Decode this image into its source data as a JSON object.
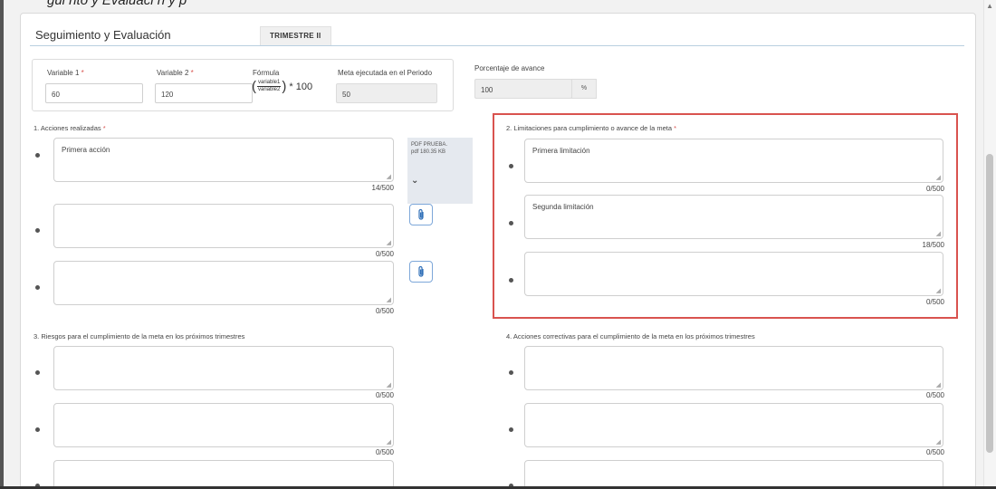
{
  "caption": "gui    nto y Evaluaci    n     y           p",
  "header": {
    "section_title": "Seguimiento y Evaluación",
    "tab_label": "TRIMESTRE II"
  },
  "variables": {
    "variable1_label": "Variable 1",
    "variable1_value": "60",
    "variable2_label": "Variable 2",
    "variable2_value": "120",
    "required_mark": "*",
    "formula_label": "Fórmula",
    "formula_num": "variable1",
    "formula_den": "variable2",
    "formula_tail": "* 100",
    "meta_label": "Meta ejecutada en el Periodo",
    "meta_value": "50",
    "porcentaje_label": "Porcentaje de avance",
    "porcentaje_value": "100",
    "porcentaje_suffix": "%"
  },
  "acciones": {
    "label": "1. Acciones realizadas",
    "items": [
      {
        "text": "Primera acción",
        "counter": "14/500"
      },
      {
        "text": "",
        "counter": "0/500"
      },
      {
        "text": "",
        "counter": "0/500"
      }
    ],
    "file": {
      "name": "PDF PRUEBA.pdf 180.35 KB",
      "chevron": "⌄"
    }
  },
  "limitaciones": {
    "label": "2. Limitaciones para cumplimiento o avance de la meta",
    "items": [
      {
        "text": "Primera limitación",
        "counter": "0/500"
      },
      {
        "text": "Segunda limitación",
        "counter": "18/500"
      },
      {
        "text": "",
        "counter": "0/500"
      }
    ]
  },
  "riesgos": {
    "label": "3. Riesgos para el cumplimiento de la meta en los próximos trimestres",
    "items": [
      {
        "text": "",
        "counter": "0/500"
      },
      {
        "text": "",
        "counter": "0/500"
      },
      {
        "text": "",
        "counter": ""
      }
    ]
  },
  "correctivas": {
    "label": "4. Acciones correctivas para el cumplimiento de la meta en los próximos trimestres",
    "items": [
      {
        "text": "",
        "counter": "0/500"
      },
      {
        "text": "",
        "counter": "0/500"
      },
      {
        "text": "",
        "counter": ""
      }
    ]
  },
  "colors": {
    "required": "#d9534f",
    "highlight": "#d9534f",
    "accent": "#2f6fb8"
  },
  "icons": {
    "attach": "paperclip-icon",
    "resize": "resize-grip-icon",
    "expand": "chevron-down-icon"
  }
}
